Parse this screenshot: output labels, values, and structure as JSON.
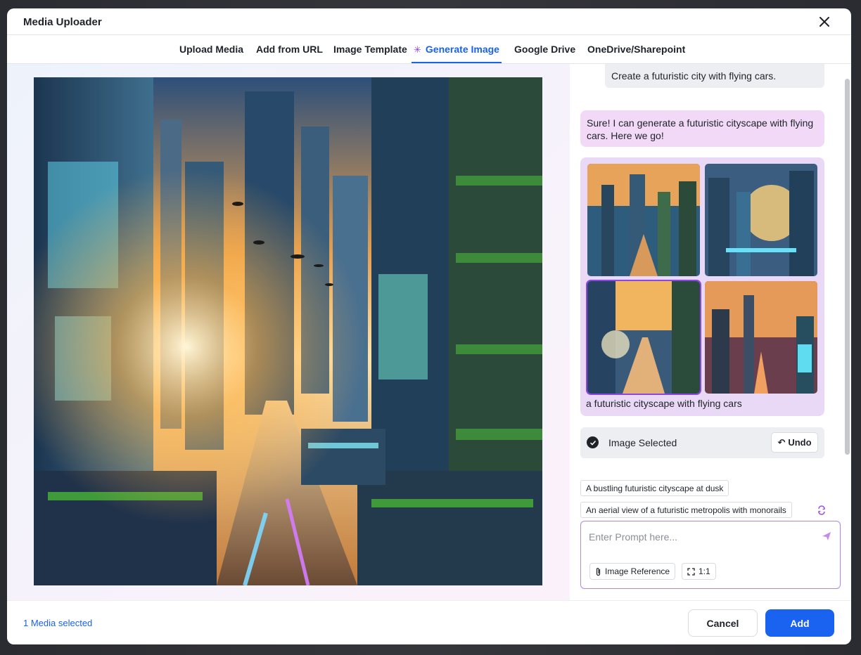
{
  "modal": {
    "title": "Media Uploader"
  },
  "tabs": [
    {
      "label": "Upload Media"
    },
    {
      "label": "Add from URL"
    },
    {
      "label": "Image Template"
    },
    {
      "label": "Generate Image",
      "active": true
    },
    {
      "label": "Google Drive"
    },
    {
      "label": "OneDrive/Sharepoint"
    }
  ],
  "chat": {
    "user_message": "Create a futuristic city with flying cars.",
    "bot_message": "Sure! I can generate a futuristic cityscape with flying cars. Here we go!",
    "gallery_caption": "a futuristic cityscape with flying cars",
    "selected_index": 2,
    "selected_label": "Image Selected",
    "undo_label": "Undo"
  },
  "suggestions": [
    "A bustling futuristic cityscape at dusk",
    "An aerial view of a futuristic metropolis with monorails"
  ],
  "prompt": {
    "placeholder": "Enter Prompt here...",
    "value": "",
    "image_reference_label": "Image Reference",
    "aspect_ratio_label": "1:1"
  },
  "footer": {
    "media_selected": "1 Media selected",
    "cancel_label": "Cancel",
    "add_label": "Add"
  },
  "colors": {
    "accent": "#1a63f0",
    "purple_accent": "#8c45e8",
    "bot_bubble": "#f1d9f7",
    "gallery_bg": "#ead8f7"
  }
}
